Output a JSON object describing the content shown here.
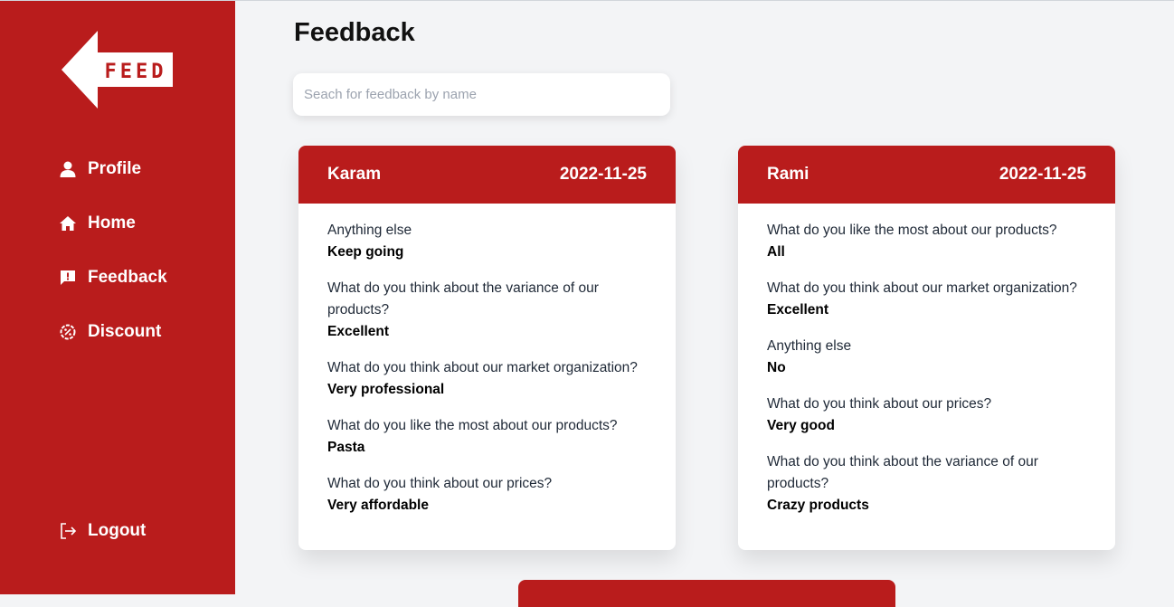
{
  "brand": {
    "logo_text": "FEED",
    "accent": "#b91c1c"
  },
  "sidebar": {
    "items": [
      {
        "label": "Profile",
        "icon": "user-icon"
      },
      {
        "label": "Home",
        "icon": "home-icon"
      },
      {
        "label": "Feedback",
        "icon": "feedback-icon"
      },
      {
        "label": "Discount",
        "icon": "discount-icon"
      }
    ],
    "logout": {
      "label": "Logout",
      "icon": "logout-icon"
    }
  },
  "header": {
    "title": "Feedback"
  },
  "search": {
    "placeholder": "Seach for feedback by name",
    "value": ""
  },
  "cards": [
    {
      "name": "Karam",
      "date": "2022-11-25",
      "items": [
        {
          "q": "Anything else",
          "a": "Keep going"
        },
        {
          "q": "What do you think about the variance of our products?",
          "a": "Excellent"
        },
        {
          "q": "What do you think about our market organization?",
          "a": "Very professional"
        },
        {
          "q": "What do you like the most about our products?",
          "a": "Pasta"
        },
        {
          "q": "What do you think about our prices?",
          "a": "Very affordable"
        }
      ]
    },
    {
      "name": "Rami",
      "date": "2022-11-25",
      "items": [
        {
          "q": "What do you like the most about our products?",
          "a": "All"
        },
        {
          "q": "What do you think about our market organization?",
          "a": "Excellent"
        },
        {
          "q": "Anything else",
          "a": "No"
        },
        {
          "q": "What do you think about our prices?",
          "a": "Very good"
        },
        {
          "q": "What do you think about the variance of our products?",
          "a": "Crazy products"
        }
      ]
    }
  ]
}
